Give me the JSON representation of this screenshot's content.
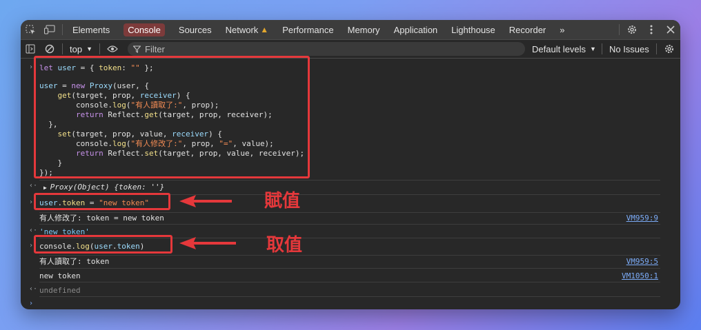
{
  "toolbar_tabs": [
    "Elements",
    "Console",
    "Sources",
    "Network",
    "Performance",
    "Memory",
    "Application",
    "Lighthouse",
    "Recorder"
  ],
  "active_tab": "Console",
  "network_warning": "▲",
  "more_tabs": "»",
  "console_toolbar": {
    "context": "top",
    "filter_placeholder": "Filter",
    "levels": "Default levels",
    "issues": "No Issues"
  },
  "code_block": {
    "line1": "let user = { token: \"\" };",
    "line2": "",
    "line3": "user = new Proxy(user, {",
    "line4": "    get(target, prop, receiver) {",
    "line5": "        console.log(\"有人讀取了:\", prop);",
    "line6": "        return Reflect.get(target, prop, receiver);",
    "line7": "  },",
    "line8": "    set(target, prop, value, receiver) {",
    "line9": "        console.log(\"有人修改了:\", prop, \"=\", value);",
    "line10": "        return Reflect.set(target, prop, value, receiver);",
    "line11": "    }",
    "line12": "});"
  },
  "result_proxy": "Proxy(Object) {token: ''}",
  "input_assign": "user.token = \"new token\"",
  "log_set": "有人修改了: token = new token",
  "log_set_source": "VM959:9",
  "result_new_token": "'new token'",
  "input_read": "console.log(user.token)",
  "log_get": "有人讀取了: token",
  "log_get_source": "VM959:5",
  "log_value": "new token",
  "log_value_source": "VM1050:1",
  "result_undefined": "undefined",
  "annotations": {
    "assign_label": "賦值",
    "read_label": "取值"
  },
  "colors": {
    "highlight_red": "#e5383b",
    "link_blue": "#7cacf8",
    "active_tab_bg": "#7d3b3b"
  }
}
